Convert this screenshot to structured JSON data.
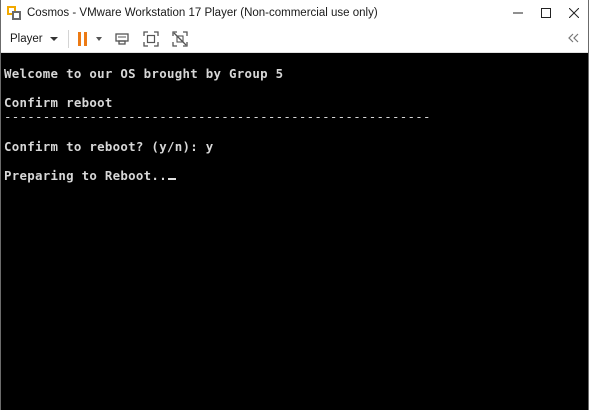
{
  "window": {
    "title": "Cosmos - VMware Workstation 17 Player (Non-commercial use only)",
    "controls": {
      "minimize": "–",
      "maximize": "☐",
      "close": "✕"
    }
  },
  "toolbar": {
    "player_label": "Player",
    "icons": [
      "pause-icon",
      "send-ctrl-alt-del-icon",
      "fit-guest-icon",
      "unity-icon",
      "collapse-toolbar-icon"
    ]
  },
  "console": {
    "welcome": "Welcome to our OS brought by Group 5",
    "confirm_header": "Confirm reboot",
    "divider": "-------------------------------------------------------",
    "prompt": "Confirm to reboot? (y/n): y",
    "status": "Preparing to Reboot.."
  },
  "colors": {
    "pause_accent": "#ec7a14",
    "console_bg": "#000000",
    "console_text": "#d7d7d7"
  }
}
